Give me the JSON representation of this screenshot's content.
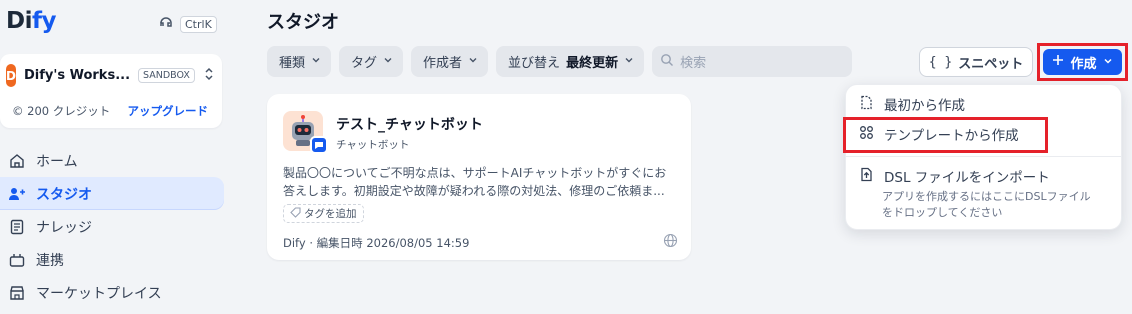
{
  "sidebar": {
    "logo_di": "Di",
    "logo_fy": "fy",
    "shortcut": "CtrlK",
    "workspace": {
      "initial": "D",
      "name": "Dify's Works...",
      "plan": "SANDBOX",
      "credits": "200 クレジット",
      "upgrade_label": "アップグレード"
    },
    "nav": [
      {
        "label": "ホーム",
        "icon": "home-icon"
      },
      {
        "label": "スタジオ",
        "icon": "studio-icon",
        "active": true
      },
      {
        "label": "ナレッジ",
        "icon": "knowledge-icon"
      },
      {
        "label": "連携",
        "icon": "integration-icon"
      },
      {
        "label": "マーケットプレイス",
        "icon": "marketplace-icon"
      }
    ]
  },
  "main": {
    "title": "スタジオ",
    "filters": {
      "type_label": "種類",
      "tag_label": "タグ",
      "creator_label": "作成者",
      "sort_label": "並び替え",
      "sort_value": "最終更新",
      "search_placeholder": "検索"
    },
    "snippet_label": "スニペット",
    "create_label": "作成"
  },
  "app_card": {
    "title": "テスト_チャットボット",
    "type": "チャットボット",
    "description": "製品〇〇についてご不明な点は、サポートAIチャットボットがすぐにお答えします。初期設定や故障が疑われる際の対処法、修理のご依頼ま...",
    "add_tag_label": "タグを追加",
    "footer": "Dify · 編集日時 2026/08/05 14:59"
  },
  "create_menu": {
    "blank_label": "最初から作成",
    "template_label": "テンプレートから作成",
    "import_label": "DSL ファイルをインポート",
    "import_hint_line1": "アプリを作成するにはここにDSLファイル",
    "import_hint_line2": "をドロップしてください"
  },
  "colors": {
    "accent": "#155aef",
    "highlight_box": "#e5212a"
  }
}
